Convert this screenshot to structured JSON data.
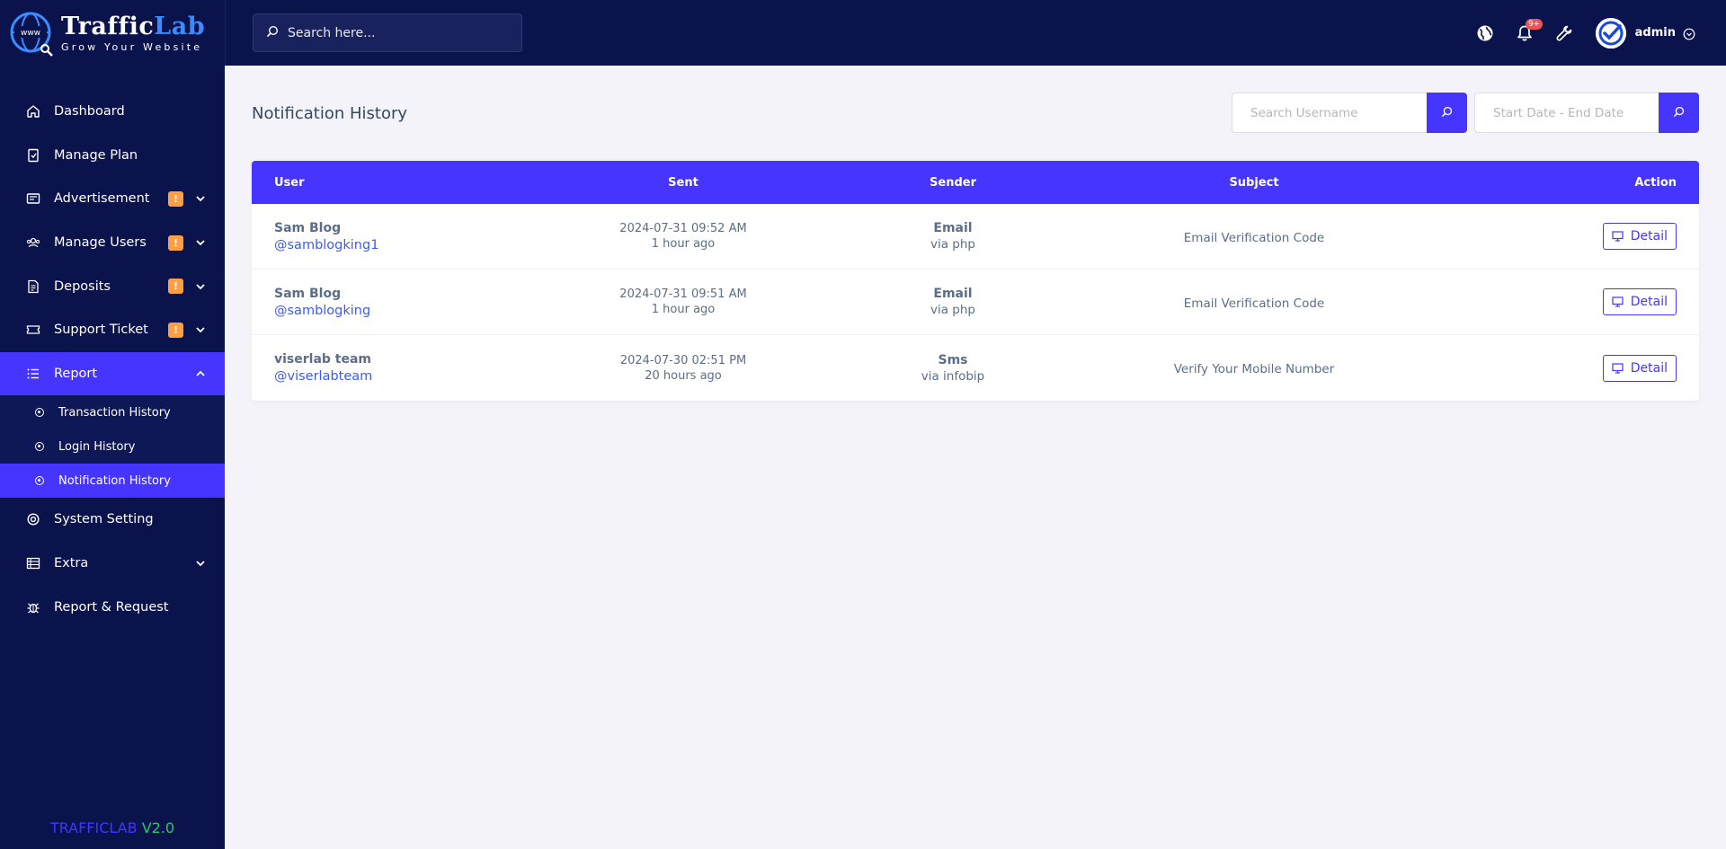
{
  "brand": {
    "name_part1": "Traffic",
    "name_part2": "Lab",
    "tagline": "Grow Your Website",
    "globe_text": "www"
  },
  "topbar": {
    "search_placeholder": "Search here...",
    "notification_count": "9+",
    "user_name": "admin"
  },
  "sidebar": {
    "items": [
      {
        "label": "Dashboard",
        "icon": "home-icon"
      },
      {
        "label": "Manage Plan",
        "icon": "plan-icon"
      },
      {
        "label": "Advertisement",
        "icon": "ad-icon",
        "badge": "!"
      },
      {
        "label": "Manage Users",
        "icon": "users-icon",
        "badge": "!"
      },
      {
        "label": "Deposits",
        "icon": "deposit-icon",
        "badge": "!"
      },
      {
        "label": "Support Ticket",
        "icon": "ticket-icon",
        "badge": "!"
      },
      {
        "label": "Report",
        "icon": "list-icon"
      },
      {
        "label": "System Setting",
        "icon": "settings-icon"
      },
      {
        "label": "Extra",
        "icon": "server-icon"
      },
      {
        "label": "Report & Request",
        "icon": "bug-icon"
      }
    ],
    "report_sub": [
      {
        "label": "Transaction History"
      },
      {
        "label": "Login History"
      },
      {
        "label": "Notification History"
      }
    ],
    "version_name": "TRAFFICLAB",
    "version_num": "V2.0"
  },
  "main": {
    "title": "Notification History",
    "search_username_placeholder": "Search Username",
    "date_placeholder": "Start Date - End Date"
  },
  "table": {
    "headers": {
      "user": "User",
      "sent": "Sent",
      "sender": "Sender",
      "subject": "Subject",
      "action": "Action"
    },
    "rows": [
      {
        "name": "Sam Blog",
        "handle": "@samblogking1",
        "date": "2024-07-31 09:52 AM",
        "ago": "1 hour ago",
        "sender": "Email",
        "via": "via php",
        "subject": "Email Verification Code",
        "action": "Detail"
      },
      {
        "name": "Sam Blog",
        "handle": "@samblogking",
        "date": "2024-07-31 09:51 AM",
        "ago": "1 hour ago",
        "sender": "Email",
        "via": "via php",
        "subject": "Email Verification Code",
        "action": "Detail"
      },
      {
        "name": "viserlab team",
        "handle": "@viserlabteam",
        "date": "2024-07-30 02:51 PM",
        "ago": "20 hours ago",
        "sender": "Sms",
        "via": "via infobip",
        "subject": "Verify Your Mobile Number",
        "action": "Detail"
      }
    ]
  }
}
